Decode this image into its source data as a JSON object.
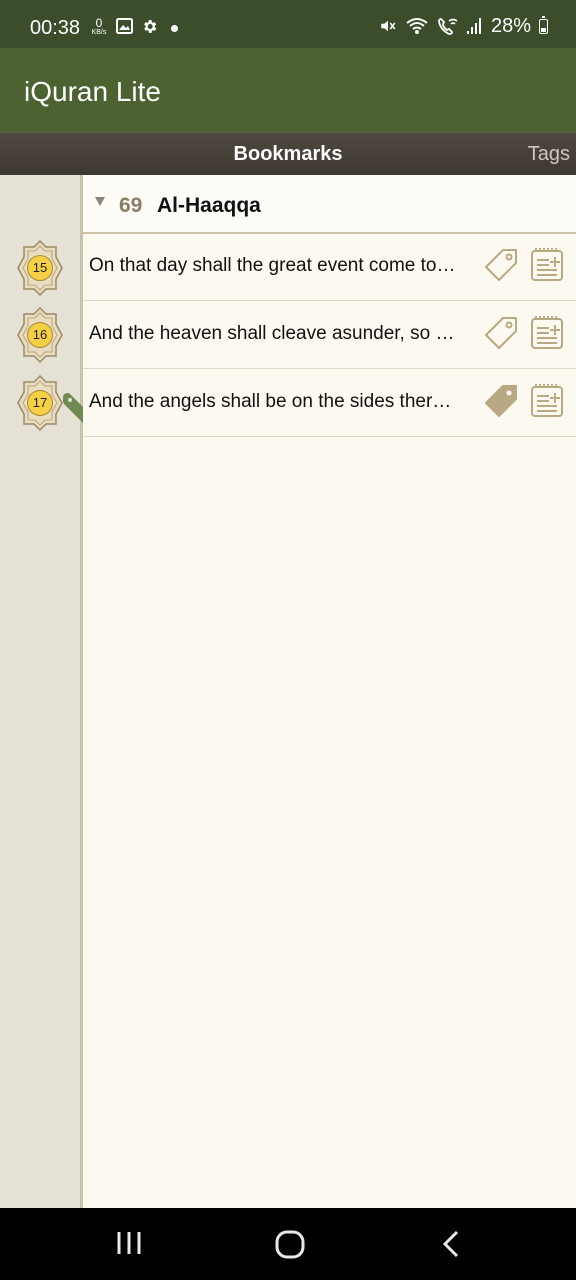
{
  "status_bar": {
    "time": "00:38",
    "network_speed": "0",
    "network_speed_unit": "KB/s",
    "battery_percent": "28%",
    "icons": [
      "gallery-icon",
      "settings-icon",
      "dot-icon",
      "mute-icon",
      "wifi-icon",
      "wifi-calling-icon",
      "signal-icon",
      "battery-icon"
    ],
    "battery_level": 0.28
  },
  "app": {
    "title": "iQuran Lite"
  },
  "tabs": {
    "bookmarks": "Bookmarks",
    "tags": "Tags"
  },
  "section": {
    "surah_number": "69",
    "surah_name": "Al-Haaqqa"
  },
  "bookmarks": [
    {
      "verse": "15",
      "text": "On that day shall the great event come to pass,",
      "tagged": false
    },
    {
      "verse": "16",
      "text": "And the heaven shall cleave asunder, so that on that day it shall be frail,",
      "tagged": false
    },
    {
      "verse": "17",
      "text": "And the angels shall be on the sides thereof;",
      "tagged": true
    }
  ],
  "colors": {
    "status_bar": "#3b4d2b",
    "app_bar": "#4d6231",
    "tab_bar": "#46403a",
    "background": "#fcfaf0",
    "gutter": "#e5e1d5",
    "accent_tan": "#b8a883",
    "badge_gold": "#f5cf44",
    "bookmark_flag": "#6f8a53"
  }
}
